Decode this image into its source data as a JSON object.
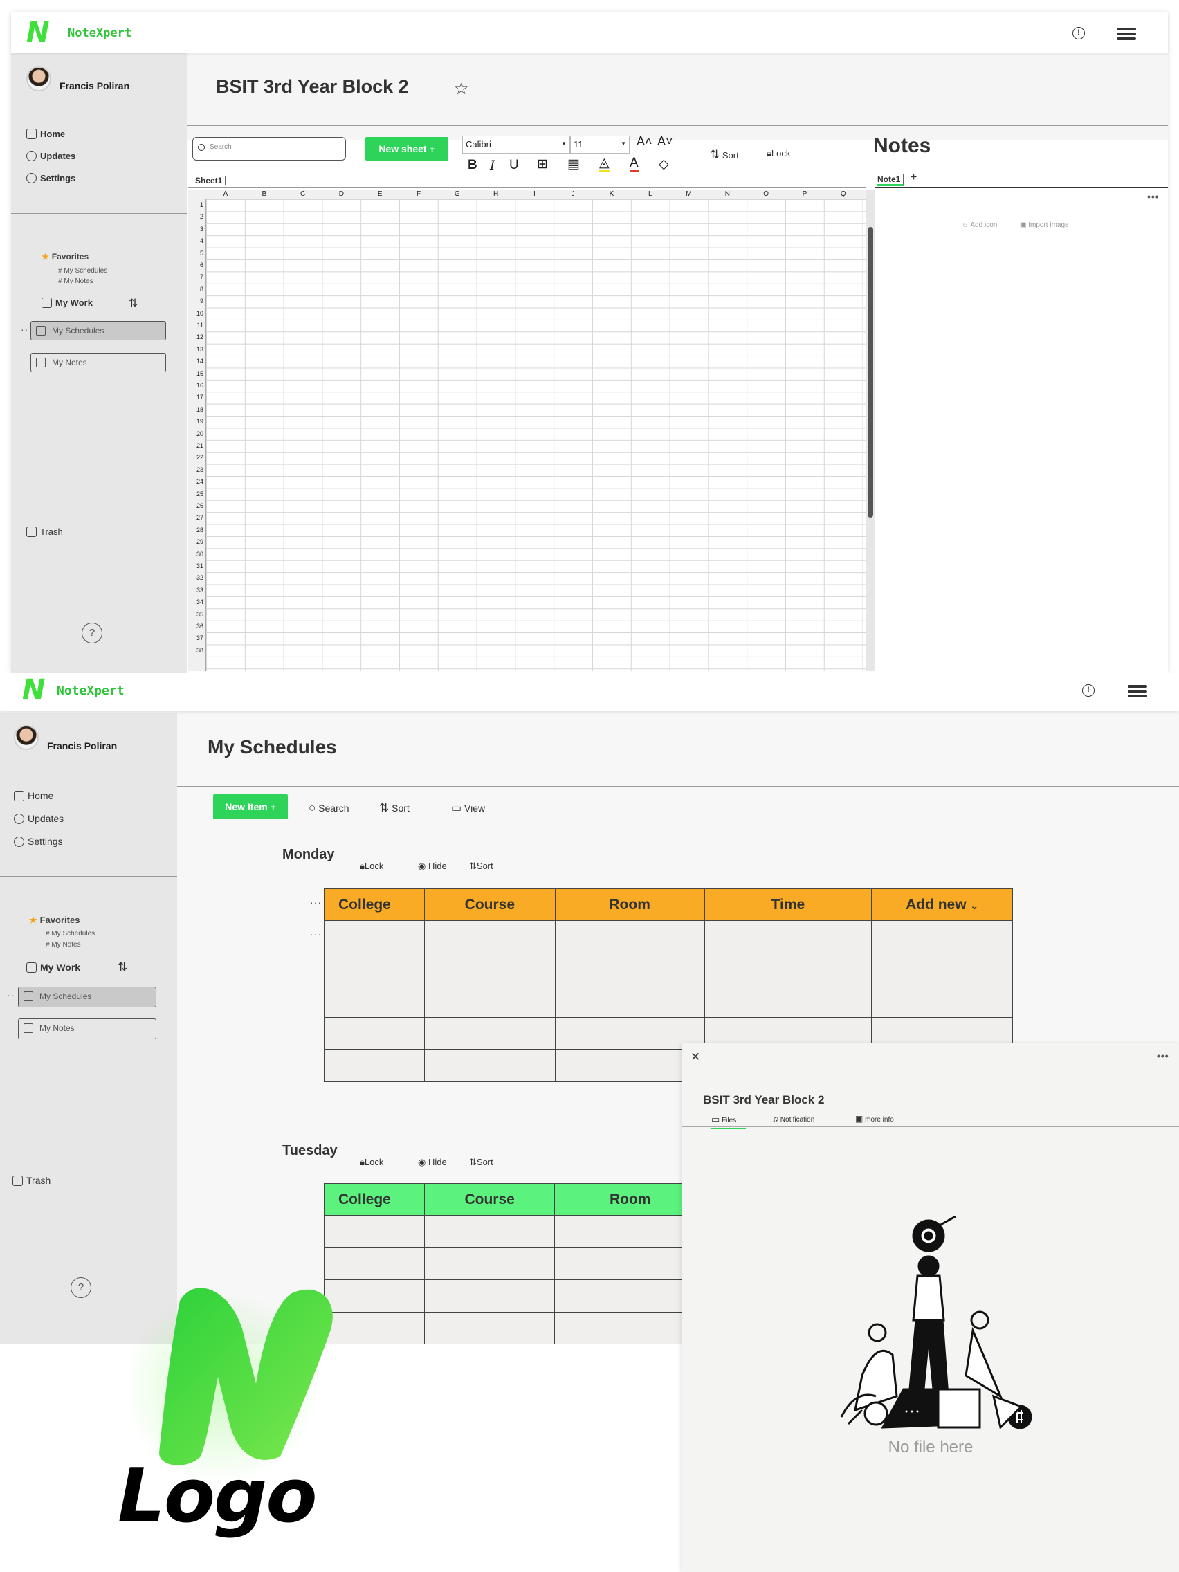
{
  "brand": {
    "letter": "N",
    "name": "NoteXpert"
  },
  "user": {
    "name": "Francis Poliran"
  },
  "sidebar": {
    "nav": [
      {
        "label": "Home",
        "icon": "home-icon"
      },
      {
        "label": "Updates",
        "icon": "clock-icon"
      },
      {
        "label": "Settings",
        "icon": "gear-icon"
      }
    ],
    "favorites_label": "Favorites",
    "favorites": [
      "My Schedules",
      "My Notes"
    ],
    "my_work_label": "My Work",
    "work_items": [
      "My Schedules",
      "My Notes"
    ],
    "trash_label": "Trash",
    "help_label": "?"
  },
  "sheet_screen": {
    "title": "BSIT 3rd Year Block 2",
    "search_placeholder": "Search",
    "new_sheet_label": "New sheet",
    "font_name": "Calibri",
    "font_size": "11",
    "sort_label": "Sort",
    "lock_label": "Lock",
    "sheet_tab": "Sheet1",
    "columns": [
      "A",
      "B",
      "C",
      "D",
      "E",
      "F",
      "G",
      "H",
      "I",
      "J",
      "K",
      "L",
      "M",
      "N",
      "O",
      "P",
      "Q"
    ],
    "row_count": 38,
    "notes_title": "Notes",
    "note_tab": "Note1",
    "add_icon_label": "Add icon",
    "import_image_label": "Import image"
  },
  "schedule_screen": {
    "title": "My Schedules",
    "new_item_label": "New Item",
    "search_label": "Search",
    "sort_label": "Sort",
    "view_label": "View",
    "lock_label": "Lock",
    "hide_label": "Hide",
    "days": [
      {
        "name": "Monday",
        "columns": [
          "College",
          "Course",
          "Room",
          "Time",
          "Add new"
        ],
        "header_color": "#f9ab25",
        "rows": 5
      },
      {
        "name": "Tuesday",
        "columns": [
          "College",
          "Course",
          "Room"
        ],
        "header_color": "#5cf27e",
        "rows": 4
      }
    ]
  },
  "panel": {
    "title": "BSIT  3rd Year Block 2",
    "tabs": [
      "Files",
      "Notification",
      "more info"
    ],
    "empty_text": "No file here"
  },
  "logo_caption": "Logo",
  "colors": {
    "green": "#2ed35a",
    "orange": "#f9ab25",
    "light_green": "#5cf27e"
  }
}
